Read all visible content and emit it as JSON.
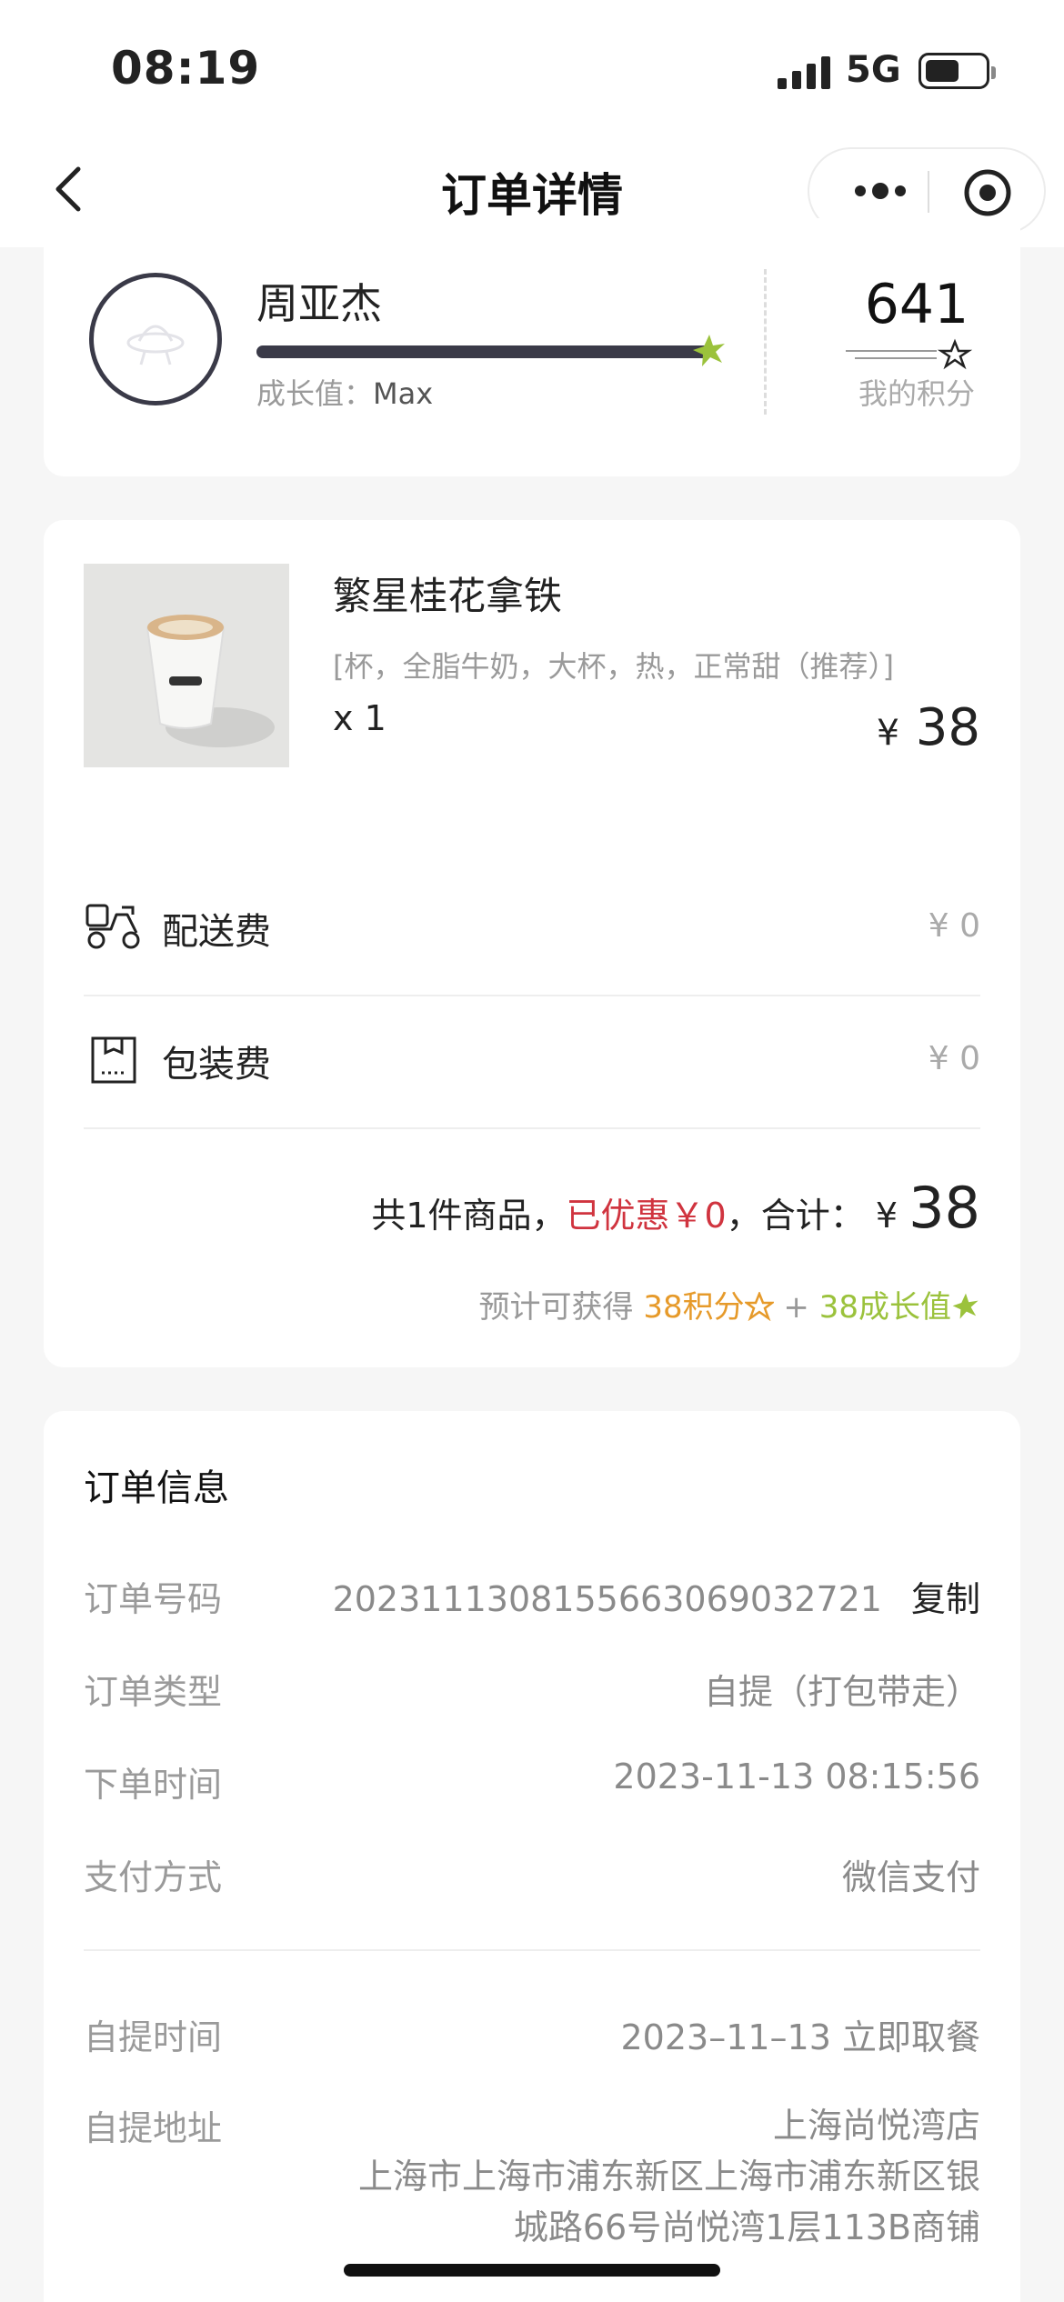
{
  "status": {
    "time": "08:19",
    "network": "5G"
  },
  "nav": {
    "title": "订单详情"
  },
  "member": {
    "name": "周亚杰",
    "growth_label": "成长值：",
    "growth_value": "Max",
    "growth_progress": 1.0,
    "points": "641",
    "points_label": "我的积分"
  },
  "product": {
    "name": "繁星桂花拿铁",
    "spec": "[杯，全脂牛奶，大杯，热，正常甜（推荐）]",
    "qty": "x 1",
    "currency": "¥",
    "price": "38"
  },
  "fees": [
    {
      "label": "配送费",
      "value": "¥ 0",
      "icon": "scooter-icon"
    },
    {
      "label": "包装费",
      "value": "¥ 0",
      "icon": "package-icon"
    }
  ],
  "summary": {
    "count_text": "共1件商品，",
    "discount_text": "已优惠￥0",
    "total_label": "，合计：",
    "currency": "¥",
    "total": "38",
    "earn_prefix": "预计可获得",
    "earn_points": "38积分",
    "plus": "+",
    "earn_growth": "38成长值"
  },
  "order_info": {
    "title": "订单信息",
    "rows": [
      {
        "label": "订单号码",
        "value": "202311130815566306903272​1",
        "action": "复制"
      },
      {
        "label": "订单类型",
        "value": "自提（打包带走）"
      },
      {
        "label": "下单时间",
        "value": "2023-11-13 08:15:56"
      },
      {
        "label": "支付方式",
        "value": "微信支付"
      }
    ],
    "pickup_time_label": "自提时间",
    "pickup_time": "2023–11–13 立即取餐",
    "pickup_addr_label": "自提地址",
    "pickup_store": "上海尚悦湾店",
    "pickup_addr": "上海市上海市浦东新区上海市浦东新区银城路66号尚悦湾1层113B商铺"
  },
  "colors": {
    "accent_red": "#d0343f",
    "points_orange": "#e69a2a",
    "growth_green": "#9bc23c"
  }
}
